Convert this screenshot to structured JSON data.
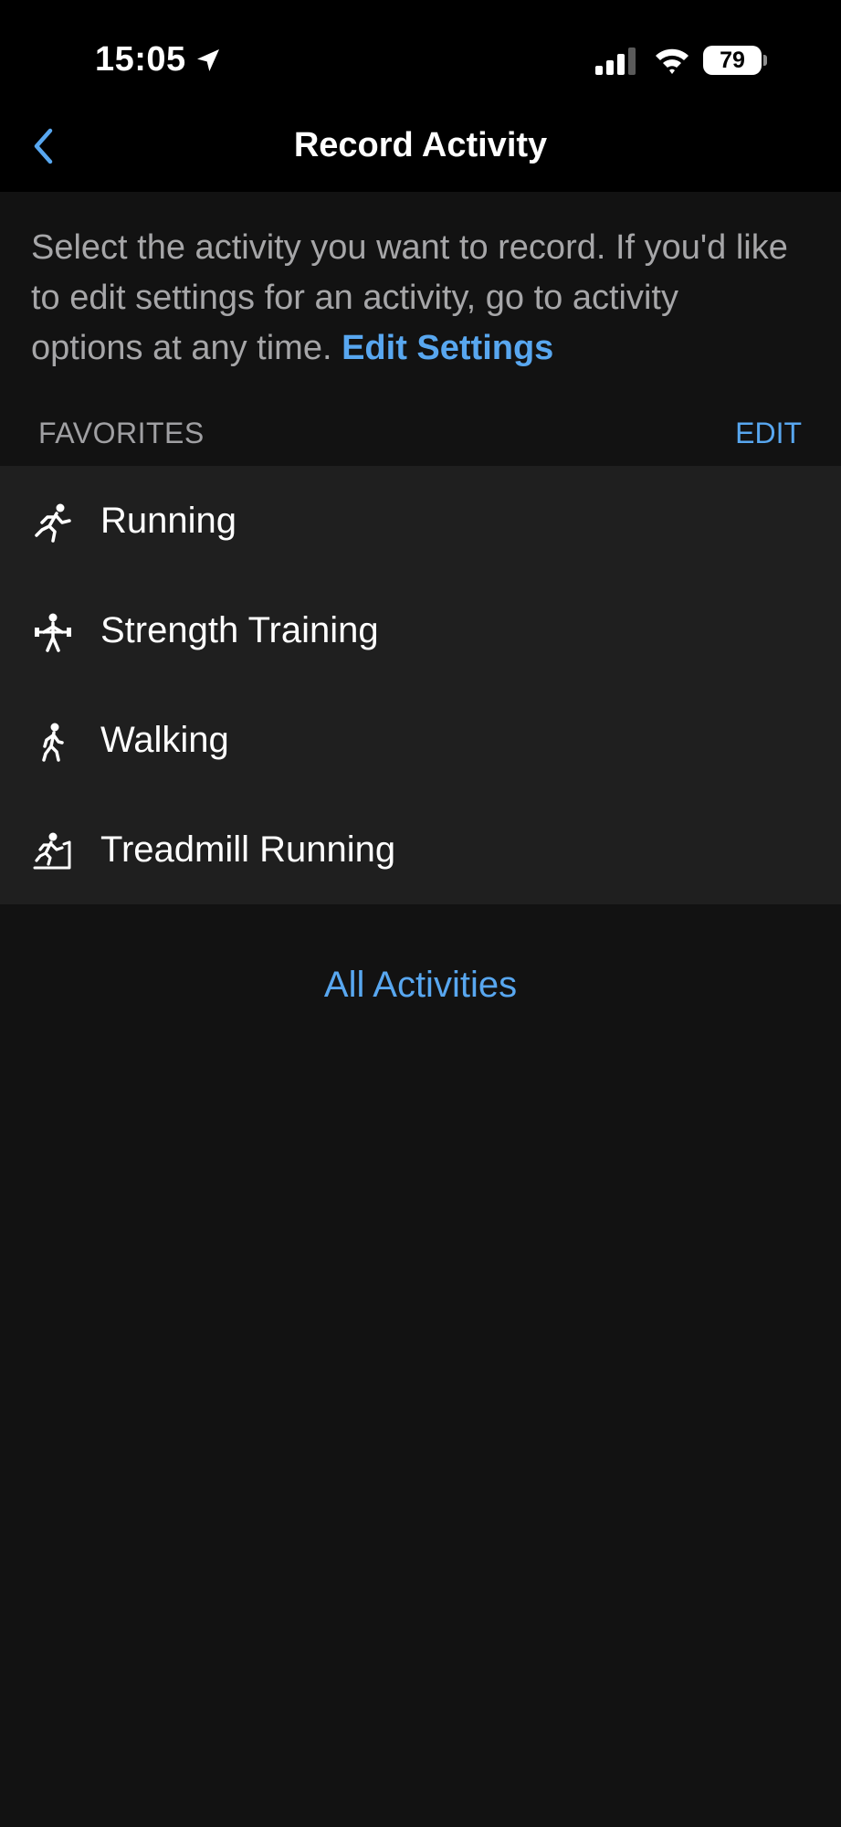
{
  "status_bar": {
    "time": "15:05",
    "battery": "79",
    "icons": [
      "location-arrow-icon",
      "cellular-signal-icon",
      "wifi-icon",
      "battery-icon"
    ]
  },
  "nav": {
    "title": "Record Activity",
    "back_icon": "chevron-left-icon"
  },
  "intro": {
    "text": "Select the activity you want to record. If you'd like to edit settings for an activity, go to activity options at any time.",
    "link": "Edit Settings"
  },
  "favorites": {
    "header": "FAVORITES",
    "edit": "EDIT",
    "items": [
      {
        "label": "Running",
        "icon": "running-icon"
      },
      {
        "label": "Strength Training",
        "icon": "strength-training-icon"
      },
      {
        "label": "Walking",
        "icon": "walking-icon"
      },
      {
        "label": "Treadmill Running",
        "icon": "treadmill-running-icon"
      }
    ]
  },
  "all_activities": "All Activities",
  "colors": {
    "background": "#121212",
    "bar": "#000000",
    "list_bg": "#1f1f1f",
    "accent": "#58a7f0",
    "secondary_text": "#a6a6a8"
  }
}
